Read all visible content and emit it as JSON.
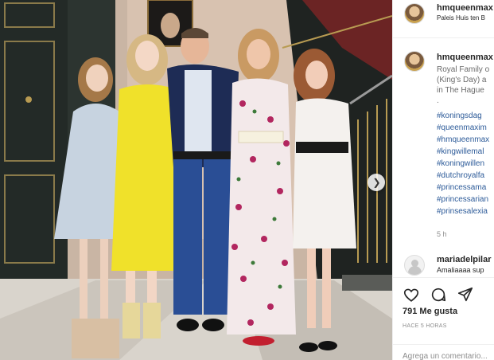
{
  "post": {
    "username": "hmqueenmax",
    "location": "Paleis Huis ten B",
    "image_alt": "Dutch royal family portrait",
    "next_icon": "chevron-right-icon"
  },
  "caption": {
    "username": "hmqueenmax",
    "lines": [
      "Royal Family o",
      "(King's Day) a",
      "in The Hague",
      "."
    ],
    "hashtags": [
      "#koningsdag",
      "#queenmaxim",
      "#hmqueenmax",
      "#kingwillemal",
      "#koningwillen",
      "#dutchroyalfa",
      "#princessama",
      "#princessarian",
      "#prinsesalexia"
    ],
    "time": "5 h"
  },
  "comment": {
    "username": "mariadelpilar",
    "text": "Amaliaaaa sup"
  },
  "actions": {
    "like_icon": "heart-icon",
    "comment_icon": "comment-icon",
    "share_icon": "share-icon"
  },
  "likes": "791 Me gusta",
  "posted_ago": "HACE 5 HORAS",
  "add_comment": {
    "placeholder": "Agrega un comentario..."
  },
  "colors": {
    "link": "#2d5b99",
    "muted": "#8e8e8e",
    "text": "#262626"
  }
}
